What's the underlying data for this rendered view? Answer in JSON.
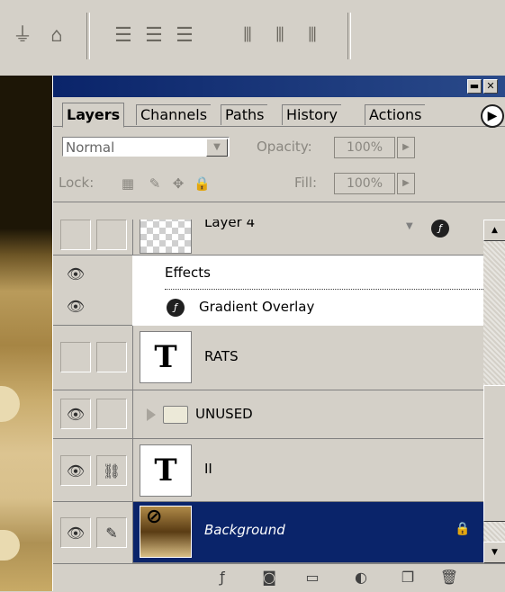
{
  "toolbar": {
    "icons": [
      "align-top-edges-icon",
      "align-bottom-edges-icon",
      "distribute-top-icon",
      "distribute-center-icon",
      "distribute-bottom-icon",
      "distribute-left-icon",
      "distribute-horizontal-icon",
      "distribute-right-icon"
    ]
  },
  "palette": {
    "tabs": [
      {
        "label": "Layers",
        "active": true
      },
      {
        "label": "Channels"
      },
      {
        "label": "Paths"
      },
      {
        "label": "History"
      },
      {
        "label": "Actions"
      }
    ],
    "blend_mode": "Normal",
    "opacity_label": "Opacity:",
    "opacity_value": "100%",
    "lock_label": "Lock:",
    "fill_label": "Fill:",
    "fill_value": "100%"
  },
  "layers": [
    {
      "name": "Layer 4",
      "eye": false,
      "link": false,
      "thumb": "transparent"
    },
    {
      "effects_label": "Effects",
      "effect": "Gradient Overlay"
    },
    {
      "name": "RATS",
      "eye": false,
      "link": false,
      "thumb": "T"
    },
    {
      "name": "UNUSED",
      "eye": true,
      "type": "folder"
    },
    {
      "name": "II",
      "eye": true,
      "link": true,
      "thumb": "T"
    },
    {
      "name": "Background",
      "eye": true,
      "selected": true,
      "thumb": "gradient"
    }
  ],
  "colors": {
    "title_bar": "#0a246a",
    "selected_row": "#0a246a",
    "panel_bg": "#d4d0c8"
  }
}
